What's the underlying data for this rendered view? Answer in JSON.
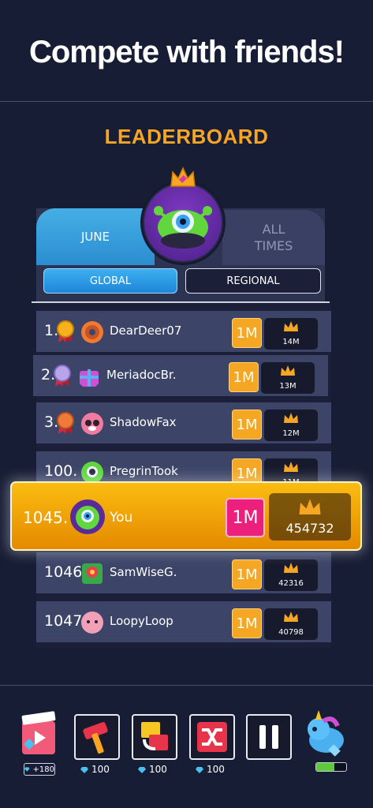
{
  "headline": "Compete with friends!",
  "leaderboard": {
    "title": "LEADERBOARD",
    "tabs": {
      "june": "JUNE",
      "all_times": "ALL TIMES"
    },
    "scope": {
      "global": "GLOBAL",
      "regional": "REGIONAL"
    },
    "multiplier": "1M",
    "rows": [
      {
        "rank": "1.",
        "name": "DearDeer07",
        "score": "14M"
      },
      {
        "rank": "2.",
        "name": "MeriadocBr.",
        "score": "13M"
      },
      {
        "rank": "3.",
        "name": "ShadowFax",
        "score": "12M"
      },
      {
        "rank": "100.",
        "name": "PregrinTook",
        "score": "11M"
      },
      {
        "rank": "1046",
        "name": "SamWiseG.",
        "score": "42316"
      },
      {
        "rank": "1047",
        "name": "LoopyLoop",
        "score": "40798"
      }
    ],
    "me": {
      "rank": "1045.",
      "name": "You",
      "score": "454732"
    }
  },
  "toolbar": {
    "video_reward": "+180",
    "costs": [
      "100",
      "100",
      "100"
    ],
    "energy_level": 0.6
  },
  "colors": {
    "accent": "#f6a623",
    "highlight": "#fbbc10",
    "pink": "#ec1f7d",
    "blue": "#2b8ed0"
  }
}
